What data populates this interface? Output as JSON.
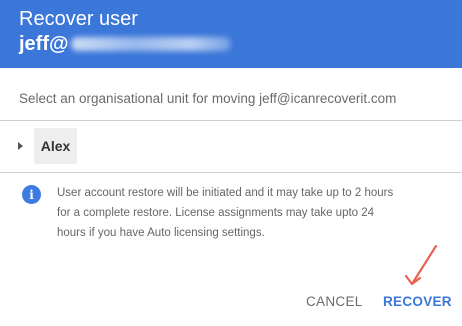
{
  "header": {
    "title": "Recover user",
    "email_prefix": "jeff@"
  },
  "prompt": "Select an organisational unit for moving jeff@icanrecoverit.com",
  "org_tree": {
    "items": [
      {
        "label": "Alex"
      }
    ]
  },
  "info": {
    "lines": [
      "User account restore will be initiated and it may take up to 2 hours",
      "for a complete restore. License assignments may take upto 24",
      "hours if you have Auto licensing settings."
    ]
  },
  "actions": {
    "cancel_label": "CANCEL",
    "recover_label": "RECOVER"
  },
  "colors": {
    "header_bg": "#3b77d9",
    "accent": "#3b77d9",
    "annotation_arrow": "#e8624f"
  }
}
